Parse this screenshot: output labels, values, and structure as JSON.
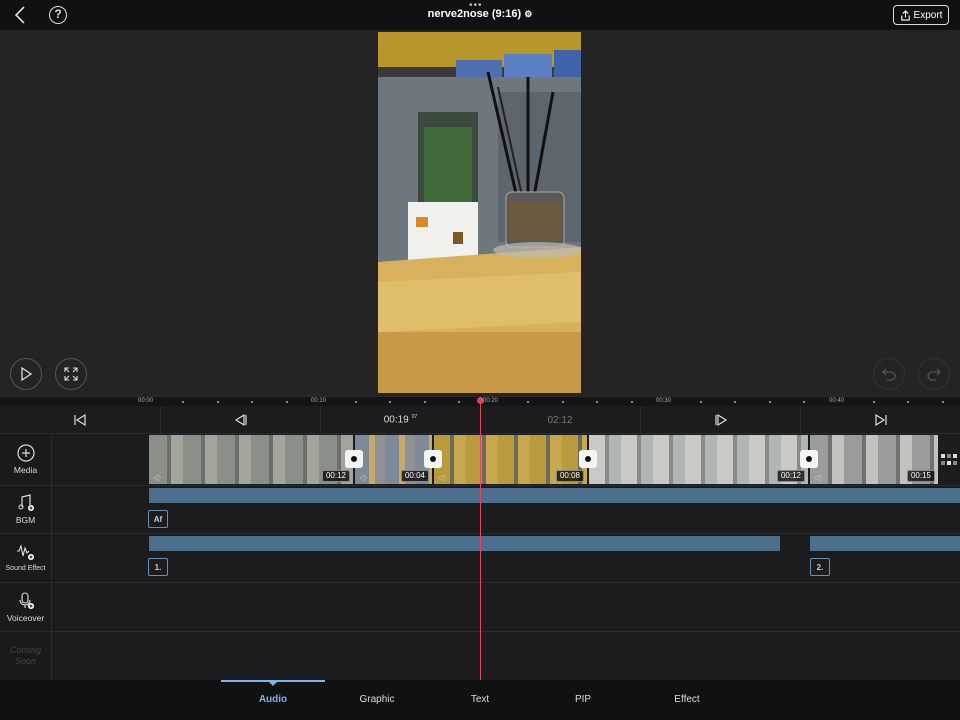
{
  "project": {
    "title": "nerve2nose (9:16)",
    "export_label": "Export"
  },
  "ruler": {
    "labels": [
      "00:00",
      "00:10",
      "00:20",
      "00:30",
      "00:40"
    ]
  },
  "transport": {
    "current_time": "00:19",
    "current_frame": "07",
    "total_time": "02:12"
  },
  "tracks": {
    "media_label": "Media",
    "bgm_label": "BGM",
    "sound_effect_label": "Sound Effect",
    "voiceover_label": "Voiceover",
    "coming_soon_label": "Coming Soon"
  },
  "clips": [
    {
      "duration": "00:12"
    },
    {
      "duration": "00:04"
    },
    {
      "duration": "00:08"
    },
    {
      "duration": "00:12"
    },
    {
      "duration": "00:15"
    }
  ],
  "bgm_tag": "Af",
  "sfx_tags": [
    "1.",
    "2."
  ],
  "tabs": [
    "Audio",
    "Graphic",
    "Text",
    "PIP",
    "Effect"
  ],
  "active_tab": "Audio"
}
